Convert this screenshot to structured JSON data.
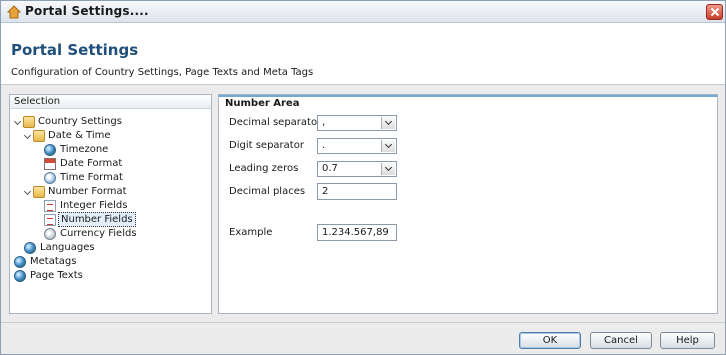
{
  "window": {
    "title": "Portal Settings....",
    "close_label": "Close"
  },
  "header": {
    "title": "Portal Settings",
    "subtitle": "Configuration of Country Settings, Page Texts and Meta Tags"
  },
  "tree": {
    "header": "Selection",
    "nodes": [
      {
        "label": "Country Settings",
        "icon": "folder-icon"
      },
      {
        "label": "Date & Time",
        "icon": "folder-icon"
      },
      {
        "label": "Timezone",
        "icon": "globe-icon"
      },
      {
        "label": "Date Format",
        "icon": "calendar-icon"
      },
      {
        "label": "Time Format",
        "icon": "clock-icon"
      },
      {
        "label": "Number Format",
        "icon": "folder-icon"
      },
      {
        "label": "Integer Fields",
        "icon": "document-icon"
      },
      {
        "label": "Number Fields",
        "icon": "document-icon",
        "selected": true
      },
      {
        "label": "Currency Fields",
        "icon": "coin-icon"
      },
      {
        "label": "Languages",
        "icon": "globe-icon"
      },
      {
        "label": "Metatags",
        "icon": "globe-icon"
      },
      {
        "label": "Page Texts",
        "icon": "globe-icon"
      }
    ]
  },
  "number_area": {
    "title": "Number Area",
    "decimal_separator": {
      "label": "Decimal separator",
      "value": ","
    },
    "digit_separator": {
      "label": "Digit separator",
      "value": "."
    },
    "leading_zeros": {
      "label": "Leading zeros",
      "value": "0.7"
    },
    "decimal_places": {
      "label": "Decimal places",
      "value": "2"
    },
    "example": {
      "label": "Example",
      "value": "1.234.567,89"
    }
  },
  "footer": {
    "ok": "OK",
    "cancel": "Cancel",
    "help": "Help"
  }
}
